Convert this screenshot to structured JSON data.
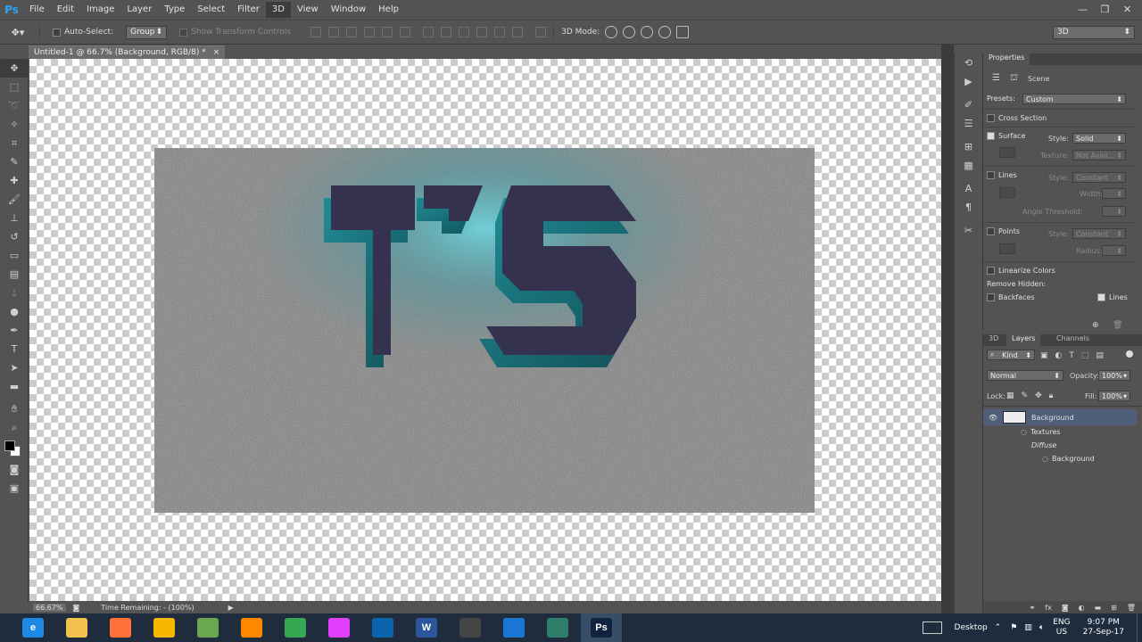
{
  "app": {
    "logo": "Ps"
  },
  "menu": [
    "File",
    "Edit",
    "Image",
    "Layer",
    "Type",
    "Select",
    "Filter",
    "3D",
    "View",
    "Window",
    "Help"
  ],
  "menu_active_index": 7,
  "window_controls": {
    "minimize": "—",
    "restore": "❐",
    "close": "✕"
  },
  "options": {
    "auto_select_label": "Auto-Select:",
    "auto_select_value": "Group",
    "show_transform_label": "Show Transform Controls",
    "mode_label": "3D Mode:",
    "workspace_value": "3D"
  },
  "document": {
    "tab_title": "Untitled-1 @ 66.7% (Background, RGB/8) *",
    "tab_close": "×"
  },
  "scene_text": "TS",
  "status": {
    "zoom": "66.67%",
    "time_remaining": "Time Remaining: - (100%)"
  },
  "properties": {
    "tab_label": "Properties",
    "section_label": "Scene",
    "presets_label": "Presets:",
    "presets_value": "Custom",
    "cross_section": "Cross Section",
    "surface": "Surface",
    "style_label": "Style:",
    "surface_style": "Solid",
    "texture_label": "Texture:",
    "texture_value": "Not Avail...",
    "lines": "Lines",
    "lines_style": "Constant",
    "width_label": "Width:",
    "angle_threshold_label": "Angle Threshold:",
    "points": "Points",
    "points_style": "Constant",
    "radius_label": "Radius:",
    "linearize_colors": "Linearize Colors",
    "remove_hidden": "Remove Hidden:",
    "backfaces": "Backfaces",
    "lines_check": "Lines"
  },
  "layers": {
    "tabs": [
      "3D",
      "Layers",
      "Channels"
    ],
    "active_tab_index": 1,
    "kind_label": "Kind",
    "blend_mode": "Normal",
    "opacity_label": "Opacity:",
    "opacity_value": "100%",
    "lock_label": "Lock:",
    "fill_label": "Fill:",
    "fill_value": "100%",
    "items": [
      {
        "name": "Background",
        "indent": 0,
        "selected": true
      },
      {
        "name": "Textures",
        "indent": 1,
        "selected": false
      },
      {
        "name": "Diffuse",
        "indent": 2,
        "selected": false,
        "italic": true
      },
      {
        "name": "Background",
        "indent": 3,
        "selected": false
      }
    ]
  },
  "taskbar": {
    "desktop_label": "Desktop",
    "lang": "ENG",
    "region": "US",
    "time": "9:07 PM",
    "date": "27-Sep-17",
    "apps": [
      {
        "icon": "internet-explorer-icon",
        "color": "#1e88e5",
        "letter": "e"
      },
      {
        "icon": "file-explorer-icon",
        "color": "#f2c14e",
        "letter": ""
      },
      {
        "icon": "firefox-icon",
        "color": "#ff7139",
        "letter": ""
      },
      {
        "icon": "lion-app-icon",
        "color": "#f5b700",
        "letter": ""
      },
      {
        "icon": "chart-app-icon",
        "color": "#6aa84f",
        "letter": ""
      },
      {
        "icon": "vlc-icon",
        "color": "#ff8800",
        "letter": ""
      },
      {
        "icon": "chrome-icon",
        "color": "#34a853",
        "letter": ""
      },
      {
        "icon": "colorful-app-icon",
        "color": "#e040fb",
        "letter": ""
      },
      {
        "icon": "outlook-app-icon",
        "color": "#0a64ad",
        "letter": ""
      },
      {
        "icon": "word-icon",
        "color": "#2b579a",
        "letter": "W"
      },
      {
        "icon": "ms-app-icon",
        "color": "#444444",
        "letter": ""
      },
      {
        "icon": "screen-capture-icon",
        "color": "#1976d2",
        "letter": ""
      },
      {
        "icon": "display-app-icon",
        "color": "#2e7d6b",
        "letter": ""
      },
      {
        "icon": "photoshop-icon",
        "color": "#0f2340",
        "letter": "Ps"
      }
    ]
  }
}
